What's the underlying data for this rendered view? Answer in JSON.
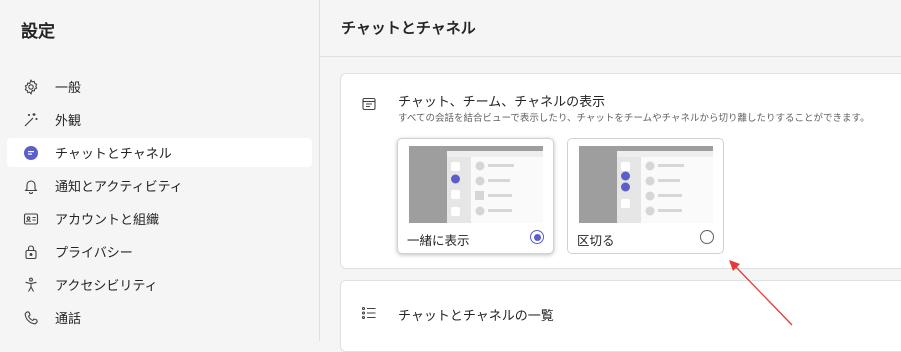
{
  "sidebar": {
    "title": "設定",
    "items": [
      {
        "label": "一般",
        "icon": "gear-icon"
      },
      {
        "label": "外観",
        "icon": "magic-wand-icon"
      },
      {
        "label": "チャットとチャネル",
        "icon": "chat-bubble-icon",
        "active": true
      },
      {
        "label": "通知とアクティビティ",
        "icon": "bell-icon"
      },
      {
        "label": "アカウントと組織",
        "icon": "id-card-icon"
      },
      {
        "label": "プライバシー",
        "icon": "lock-icon"
      },
      {
        "label": "アクセシビリティ",
        "icon": "accessibility-icon"
      },
      {
        "label": "通話",
        "icon": "phone-icon"
      }
    ]
  },
  "header": {
    "title": "チャットとチャネル"
  },
  "display_section": {
    "title": "チャット、チーム、チャネルの表示",
    "description": "すべての会話を結合ビューで表示したり、チャットをチームやチャネルから切り離したりすることができます。",
    "icon": "layout-icon",
    "options": [
      {
        "label": "一緒に表示",
        "selected": true
      },
      {
        "label": "区切る",
        "selected": false
      }
    ]
  },
  "list_section": {
    "title": "チャットとチャネルの一覧",
    "icon": "list-icon"
  },
  "colors": {
    "accent": "#5b5fc7",
    "annotation_arrow": "#e53935"
  }
}
